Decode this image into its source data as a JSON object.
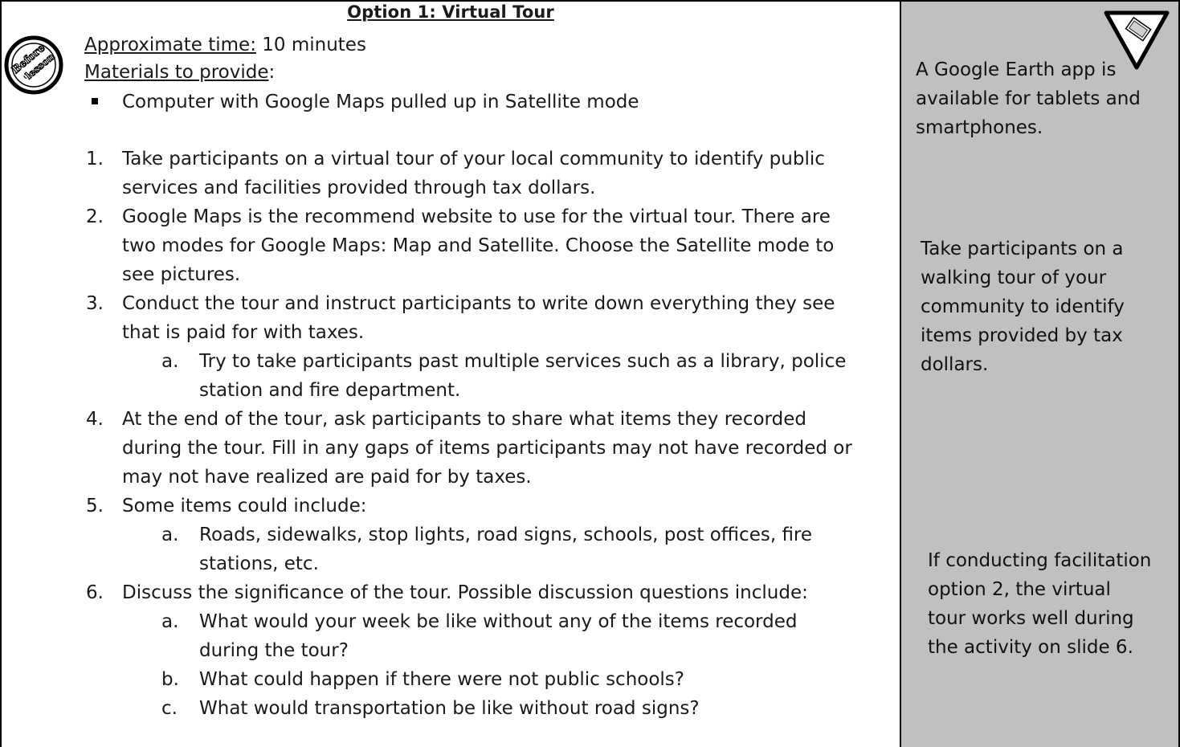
{
  "title": "Option 1: Virtual Tour",
  "badge": {
    "line1": "Before",
    "line2": "the",
    "line3": "lesson"
  },
  "approx_label": "Approximate time:",
  "approx_value": " 10 minutes",
  "materials_label": "Materials to provide",
  "materials_colon": ":",
  "materials_item": "Computer with Google Maps pulled up in Satellite mode",
  "steps": [
    {
      "num": "1.",
      "lines": [
        "Take participants on a virtual tour of your local community to identify public",
        "services and facilities provided through tax dollars."
      ]
    },
    {
      "num": "2.",
      "lines": [
        "Google Maps is the recommend website to use for the virtual tour. There are",
        "two modes for Google Maps: Map and Satellite. Choose the Satellite mode to",
        "see pictures."
      ]
    },
    {
      "num": "3.",
      "lines": [
        "Conduct the tour and instruct participants to write down everything they see",
        "that is paid for with taxes."
      ]
    },
    {
      "num": "a.",
      "lines": [
        "Try to take participants past multiple services such as a library, police",
        "station and fire department."
      ]
    },
    {
      "num": "4.",
      "lines": [
        "At the end of the tour, ask participants to share what items they recorded",
        "during the tour. Fill in any gaps of items participants may not have recorded or",
        "may not have realized are paid for by taxes."
      ]
    },
    {
      "num": "5.",
      "lines": [
        "Some items could include:"
      ]
    },
    {
      "num": "a.",
      "lines": [
        "Roads, sidewalks, stop lights, road signs, schools, post offices, fire",
        "stations, etc."
      ]
    },
    {
      "num": "6.",
      "lines": [
        "Discuss the significance of the tour. Possible discussion questions include:"
      ]
    },
    {
      "num": "a.",
      "lines": [
        "What would your week be like without any of the items recorded",
        "during the tour?"
      ]
    },
    {
      "num": "b.",
      "lines": [
        "What could happen if there were not public schools?"
      ]
    },
    {
      "num": "c.",
      "lines": [
        "What would transportation be like without road signs?"
      ]
    }
  ],
  "sidebar": {
    "note1": [
      "A Google Earth app is",
      "available for tablets and",
      "smartphones."
    ],
    "note2": [
      "Take participants on a",
      "walking tour of your",
      "community to identify",
      "items provided by tax",
      "dollars."
    ],
    "note3": [
      "If conducting facilitation",
      "option 2, the virtual",
      "tour works well during",
      "the activity on slide 6."
    ]
  }
}
